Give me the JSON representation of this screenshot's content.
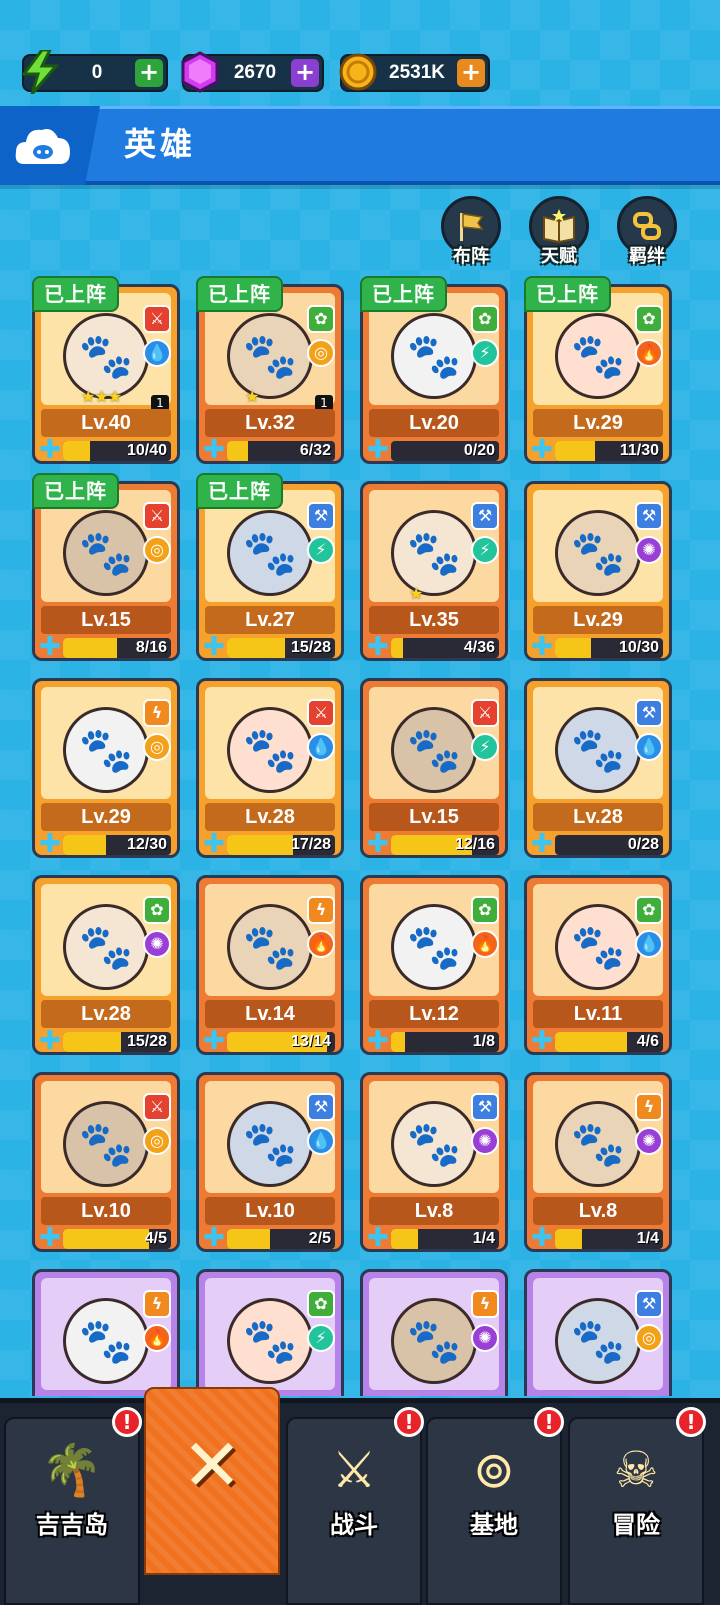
{
  "resources": [
    {
      "name": "energy",
      "icon": "lightning-icon",
      "value": "0",
      "plus_color": "#2fa33c"
    },
    {
      "name": "gems",
      "icon": "gem-icon",
      "value": "2670",
      "plus_color": "#8a3fd0"
    },
    {
      "name": "coins",
      "icon": "coin-icon",
      "value": "2531K",
      "plus_color": "#e88a1e"
    }
  ],
  "header": {
    "title": "英雄",
    "icon": "cloud-pig-icon"
  },
  "actions": [
    {
      "label": "布阵",
      "icon": "flag-icon"
    },
    {
      "label": "天赋",
      "icon": "book-icon"
    },
    {
      "label": "羁绊",
      "icon": "link-icon"
    }
  ],
  "deployed_label": "已上阵",
  "heroes": [
    {
      "level": "Lv.40",
      "progress": "10/40",
      "fraction": 0.25,
      "rarity": "gold",
      "class": "sword",
      "element": "water",
      "deployed": true,
      "stars": 3,
      "count": "1"
    },
    {
      "level": "Lv.32",
      "progress": "6/32",
      "fraction": 0.19,
      "rarity": "orange",
      "class": "paw",
      "element": "swirl",
      "deployed": true,
      "stars": 1,
      "count": "1"
    },
    {
      "level": "Lv.20",
      "progress": "0/20",
      "fraction": 0,
      "rarity": "orange",
      "class": "paw",
      "element": "light",
      "deployed": true
    },
    {
      "level": "Lv.29",
      "progress": "11/30",
      "fraction": 0.37,
      "rarity": "gold",
      "class": "paw",
      "element": "fire",
      "deployed": true
    },
    {
      "level": "Lv.15",
      "progress": "8/16",
      "fraction": 0.5,
      "rarity": "orange",
      "class": "sword",
      "element": "swirl",
      "deployed": true
    },
    {
      "level": "Lv.27",
      "progress": "15/28",
      "fraction": 0.54,
      "rarity": "gold",
      "class": "hammer",
      "element": "light",
      "deployed": true
    },
    {
      "level": "Lv.35",
      "progress": "4/36",
      "fraction": 0.11,
      "rarity": "orange",
      "class": "hammer",
      "element": "light",
      "stars": 1
    },
    {
      "level": "Lv.29",
      "progress": "10/30",
      "fraction": 0.33,
      "rarity": "gold",
      "class": "hammer",
      "element": "void"
    },
    {
      "level": "Lv.29",
      "progress": "12/30",
      "fraction": 0.4,
      "rarity": "gold",
      "class": "bolt",
      "element": "swirl"
    },
    {
      "level": "Lv.28",
      "progress": "17/28",
      "fraction": 0.61,
      "rarity": "gold",
      "class": "sword",
      "element": "water"
    },
    {
      "level": "Lv.15",
      "progress": "12/16",
      "fraction": 0.75,
      "rarity": "orange",
      "class": "sword",
      "element": "light"
    },
    {
      "level": "Lv.28",
      "progress": "0/28",
      "fraction": 0,
      "rarity": "gold",
      "class": "hammer",
      "element": "water"
    },
    {
      "level": "Lv.28",
      "progress": "15/28",
      "fraction": 0.54,
      "rarity": "gold",
      "class": "paw",
      "element": "void"
    },
    {
      "level": "Lv.14",
      "progress": "13/14",
      "fraction": 0.93,
      "rarity": "orange",
      "class": "bolt",
      "element": "fire"
    },
    {
      "level": "Lv.12",
      "progress": "1/8",
      "fraction": 0.13,
      "rarity": "orange",
      "class": "paw",
      "element": "fire"
    },
    {
      "level": "Lv.11",
      "progress": "4/6",
      "fraction": 0.67,
      "rarity": "orange",
      "class": "paw",
      "element": "water"
    },
    {
      "level": "Lv.10",
      "progress": "4/5",
      "fraction": 0.8,
      "rarity": "orange",
      "class": "sword",
      "element": "swirl"
    },
    {
      "level": "Lv.10",
      "progress": "2/5",
      "fraction": 0.4,
      "rarity": "orange",
      "class": "hammer",
      "element": "water"
    },
    {
      "level": "Lv.8",
      "progress": "1/4",
      "fraction": 0.25,
      "rarity": "orange",
      "class": "hammer",
      "element": "void"
    },
    {
      "level": "Lv.8",
      "progress": "1/4",
      "fraction": 0.25,
      "rarity": "orange",
      "class": "bolt",
      "element": "void"
    },
    {
      "level": "",
      "progress": "",
      "fraction": 0,
      "rarity": "purple",
      "class": "bolt",
      "element": "fire"
    },
    {
      "level": "",
      "progress": "",
      "fraction": 0,
      "rarity": "purple",
      "class": "paw",
      "element": "light"
    },
    {
      "level": "",
      "progress": "",
      "fraction": 0,
      "rarity": "purple",
      "class": "bolt",
      "element": "void"
    },
    {
      "level": "",
      "progress": "",
      "fraction": 0,
      "rarity": "purple",
      "class": "hammer",
      "element": "swirl"
    }
  ],
  "nav": [
    {
      "label": "吉吉岛",
      "icon": "palm-island-icon",
      "alert": "!"
    },
    {
      "label": "",
      "icon": "close-icon",
      "active": true
    },
    {
      "label": "战斗",
      "icon": "crossed-swords-icon",
      "alert": "!"
    },
    {
      "label": "基地",
      "icon": "base-icon",
      "alert": "!"
    },
    {
      "label": "冒险",
      "icon": "skull-icon",
      "alert": "!"
    }
  ]
}
